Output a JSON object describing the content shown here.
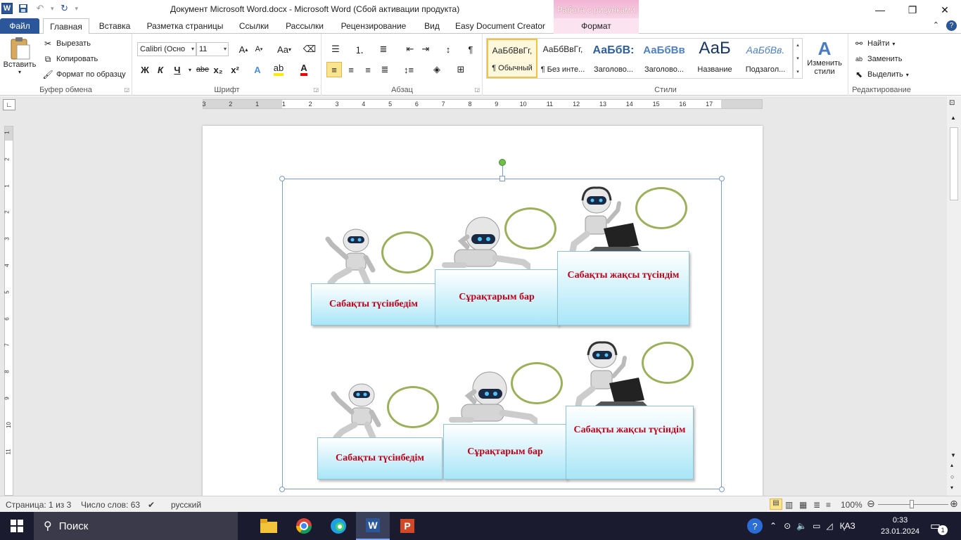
{
  "titlebar": {
    "title": "Документ Microsoft Word.docx  -  Microsoft Word (Сбой активации продукта)",
    "context_header": "Работа с рисунками"
  },
  "tabs": {
    "file": "Файл",
    "home": "Главная",
    "insert": "Вставка",
    "layout": "Разметка страницы",
    "refs": "Ссылки",
    "mailings": "Рассылки",
    "review": "Рецензирование",
    "view": "Вид",
    "easydoc": "Easy Document Creator",
    "format": "Формат"
  },
  "clipboard": {
    "paste": "Вставить",
    "cut": "Вырезать",
    "copy": "Копировать",
    "format_painter": "Формат по образцу",
    "label": "Буфер обмена"
  },
  "font": {
    "name": "Calibri (Осно",
    "size": "11",
    "label": "Шрифт",
    "bold": "Ж",
    "italic": "К",
    "underline": "Ч",
    "strike": "abe",
    "sub": "x₂",
    "sup": "x²",
    "case": "Aa"
  },
  "paragraph": {
    "label": "Абзац"
  },
  "styles": {
    "label": "Стили",
    "items": [
      {
        "sample": "АаБбВвГг,",
        "name": "¶ Обычный"
      },
      {
        "sample": "АаБбВвГг,",
        "name": "¶ Без инте..."
      },
      {
        "sample": "АаБбВ:",
        "name": "Заголово..."
      },
      {
        "sample": "АаБбВв",
        "name": "Заголово..."
      },
      {
        "sample": "АаБ",
        "name": "Название"
      },
      {
        "sample": "АаБбВв.",
        "name": "Подзагол..."
      }
    ],
    "change": "Изменить стили"
  },
  "editing": {
    "find": "Найти",
    "replace": "Заменить",
    "select": "Выделить",
    "label": "Редактирование"
  },
  "ruler": {
    "ticks": [
      "3",
      "2",
      "1",
      "1",
      "2",
      "3",
      "4",
      "5",
      "6",
      "7",
      "8",
      "9",
      "10",
      "11",
      "12",
      "13",
      "14",
      "15",
      "16",
      "17"
    ],
    "vticks": [
      "1",
      "2",
      "1",
      "2",
      "3",
      "4",
      "5",
      "6",
      "7",
      "8",
      "9",
      "10",
      "11"
    ]
  },
  "diagram": {
    "row1": {
      "a": "Сабақты түсінбедім",
      "b": "Сұрақтарым бар",
      "c": "Сабақты жақсы түсіндім"
    },
    "row2": {
      "a": "Сабақты түсінбедім",
      "b": "Сұрақтарым бар",
      "c": "Сабақты жақсы түсіндім"
    }
  },
  "status": {
    "page": "Страница: 1 из 3",
    "words": "Число слов: 63",
    "lang": "русский",
    "zoom": "100%"
  },
  "taskbar": {
    "search": "Поиск",
    "lang": "ҚАЗ",
    "time": "0:33",
    "date": "23.01.2024",
    "notif_count": "1"
  },
  "colors": {
    "accent": "#2b579a",
    "box_text": "#c0001a",
    "bubble": "#9bb05a",
    "context_tab": "#f2b4d4"
  }
}
